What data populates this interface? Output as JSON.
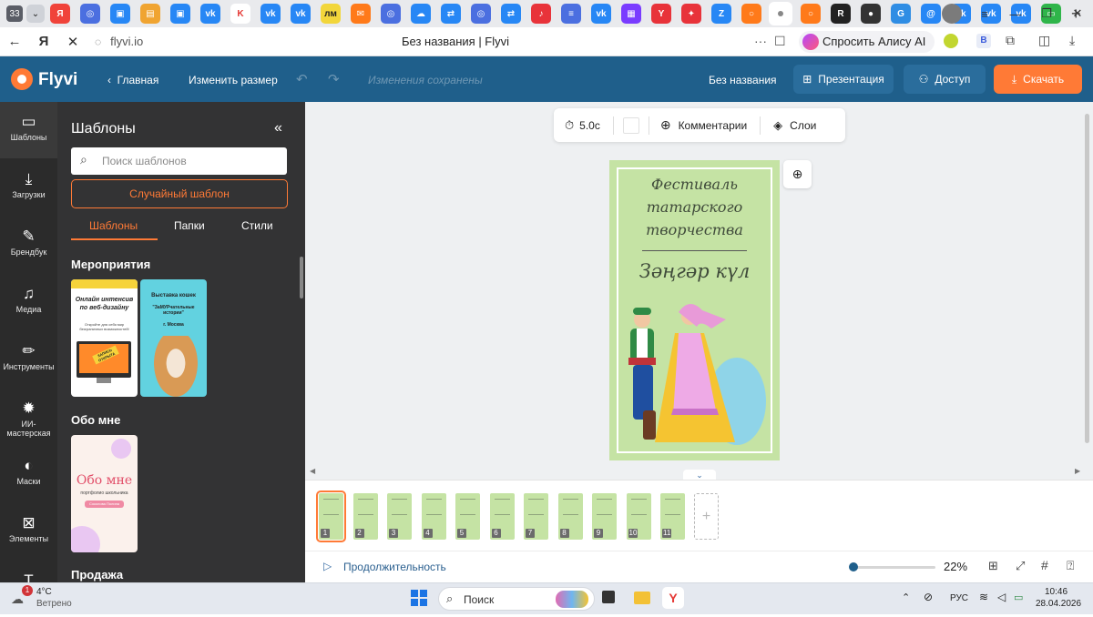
{
  "browser": {
    "tab_count": "33",
    "tab_icons": [
      {
        "name": "yandex",
        "color": "#f0433a",
        "glyph": "Я"
      },
      {
        "name": "mail",
        "color": "#4b6fe0",
        "glyph": "◎"
      },
      {
        "name": "vk",
        "color": "#2787f5",
        "glyph": "▣"
      },
      {
        "name": "folder",
        "color": "#f0a431",
        "glyph": "▤"
      },
      {
        "name": "vk",
        "color": "#2787f5",
        "glyph": "▣"
      },
      {
        "name": "vk",
        "color": "#2787f5",
        "glyph": "vk"
      },
      {
        "name": "kinopoisk",
        "color": "#ffffff",
        "glyph": "K"
      },
      {
        "name": "vk",
        "color": "#2787f5",
        "glyph": "vk"
      },
      {
        "name": "vk",
        "color": "#2787f5",
        "glyph": "vk"
      },
      {
        "name": "lm",
        "color": "#f2d63b",
        "glyph": "лм"
      },
      {
        "name": "mail",
        "color": "#ff7a1a",
        "glyph": "✉"
      },
      {
        "name": "circle",
        "color": "#4b6fe0",
        "glyph": "◎"
      },
      {
        "name": "cloud",
        "color": "#2787f5",
        "glyph": "☁"
      },
      {
        "name": "arrows",
        "color": "#2787f5",
        "glyph": "⇄"
      },
      {
        "name": "circle",
        "color": "#4b6fe0",
        "glyph": "◎"
      },
      {
        "name": "arrows",
        "color": "#2787f5",
        "glyph": "⇄"
      },
      {
        "name": "music",
        "color": "#e8333a",
        "glyph": "♪"
      },
      {
        "name": "doc",
        "color": "#4b6fe0",
        "glyph": "≡"
      },
      {
        "name": "vk",
        "color": "#2787f5",
        "glyph": "vk"
      },
      {
        "name": "app",
        "color": "#7a3cff",
        "glyph": "▦"
      },
      {
        "name": "y",
        "color": "#e8333a",
        "glyph": "Y"
      },
      {
        "name": "puzzle",
        "color": "#e8333a",
        "glyph": "✦"
      },
      {
        "name": "z",
        "color": "#2787f5",
        "glyph": "Z"
      },
      {
        "name": "circle",
        "color": "#ff7a1a",
        "glyph": "○"
      }
    ],
    "tab_icons_right": [
      {
        "name": "circle",
        "color": "#ff7a1a",
        "glyph": "○"
      },
      {
        "name": "r",
        "color": "#222222",
        "glyph": "R"
      },
      {
        "name": "sphere",
        "color": "#333333",
        "glyph": "●"
      },
      {
        "name": "g",
        "color": "#2f8de4",
        "glyph": "G"
      },
      {
        "name": "at",
        "color": "#2787f5",
        "glyph": "@"
      },
      {
        "name": "vk",
        "color": "#2787f5",
        "glyph": "vk"
      },
      {
        "name": "vk",
        "color": "#2787f5",
        "glyph": "vk"
      },
      {
        "name": "vk",
        "color": "#2787f5",
        "glyph": "vk"
      },
      {
        "name": "chat",
        "color": "#2fb54a",
        "glyph": "▭"
      }
    ],
    "url": "flyvi.io",
    "page_title": "Без названия | Flyvi",
    "alice_label": "Спросить Алису AI"
  },
  "header": {
    "logo": "Flyvi",
    "home": "Главная",
    "resize": "Изменить размер",
    "saved": "Изменения сохранены",
    "doc_name": "Без названия",
    "presentation": "Презентация",
    "access": "Доступ",
    "download": "Скачать"
  },
  "rail": [
    {
      "label": "Шаблоны",
      "icon": "▭"
    },
    {
      "label": "Загрузки",
      "icon": "⤓"
    },
    {
      "label": "Брендбук",
      "icon": "✎"
    },
    {
      "label": "Медиа",
      "icon": "♫"
    },
    {
      "label": "Инструменты",
      "icon": "✏"
    },
    {
      "label": "ИИ-мастерская",
      "icon": "✹"
    },
    {
      "label": "Маски",
      "icon": "◐"
    },
    {
      "label": "Элементы",
      "icon": "⊠"
    },
    {
      "label": "",
      "icon": "T"
    }
  ],
  "panel": {
    "title": "Шаблоны",
    "search_placeholder": "Поиск шаблонов",
    "random": "Случайный шаблон",
    "tabs": [
      "Шаблоны",
      "Папки",
      "Стили"
    ],
    "sections": [
      "Мероприятия",
      "Обо мне",
      "Продажа"
    ],
    "tmpl1": {
      "title": "Онлайн интенсив по веб-дизайну",
      "sub": "Откройте для себя мир безграничных возможностей!",
      "badge": "ЗАПИСЬ ОТКРЫТА"
    },
    "tmpl2": {
      "title": "Выставка кошек",
      "quote": "\"ЗаМУРчательные истории\"",
      "city": "г. Москва"
    },
    "tmpl3": {
      "title": "Обо мне",
      "sub": "портфолио школьника",
      "name": "Соколова Полина"
    }
  },
  "toolbar": {
    "duration": "5.0с",
    "comments": "Комментарии",
    "layers": "Слои"
  },
  "slide": {
    "line1": "Фестиваль",
    "line2": "татарского",
    "line3": "творчества",
    "line4": "Зәңгәр күл"
  },
  "thumbs": [
    "1",
    "2",
    "3",
    "4",
    "5",
    "6",
    "7",
    "8",
    "9",
    "10",
    "11"
  ],
  "bottom": {
    "duration_label": "Продолжительность",
    "zoom": "22%",
    "zoom_level": 0.0
  },
  "taskbar": {
    "weather_temp": "4°C",
    "weather_desc": "Ветрено",
    "weather_badge": "1",
    "search": "Поиск",
    "lang": "РУС",
    "time": "10:46",
    "date": "28.04.2026"
  }
}
